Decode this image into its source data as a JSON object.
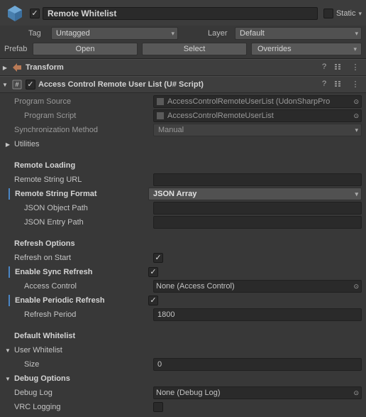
{
  "header": {
    "name": "Remote Whitelist",
    "static_label": "Static",
    "tag_label": "Tag",
    "tag_value": "Untagged",
    "layer_label": "Layer",
    "layer_value": "Default",
    "prefab_label": "Prefab",
    "open_btn": "Open",
    "select_btn": "Select",
    "overrides_btn": "Overrides"
  },
  "components": {
    "transform": {
      "title": "Transform"
    },
    "script": {
      "title": "Access Control Remote User List (U# Script)",
      "program_source_label": "Program Source",
      "program_source_value": "AccessControlRemoteUserList (UdonSharpPro",
      "program_script_label": "Program Script",
      "program_script_value": "AccessControlRemoteUserList",
      "sync_label": "Synchronization Method",
      "sync_value": "Manual",
      "utilities": "Utilities",
      "remote_loading": "Remote Loading",
      "remote_url_label": "Remote String URL",
      "remote_url_value": "",
      "remote_format_label": "Remote String Format",
      "remote_format_value": "JSON Array",
      "json_obj_label": "JSON Object Path",
      "json_obj_value": "",
      "json_entry_label": "JSON Entry Path",
      "json_entry_value": "",
      "refresh_options": "Refresh Options",
      "refresh_start_label": "Refresh on Start",
      "enable_sync_label": "Enable Sync Refresh",
      "access_control_label": "Access Control",
      "access_control_value": "None (Access Control)",
      "enable_periodic_label": "Enable Periodic Refresh",
      "refresh_period_label": "Refresh Period",
      "refresh_period_value": "1800",
      "default_whitelist": "Default Whitelist",
      "user_whitelist": "User Whitelist",
      "size_label": "Size",
      "size_value": "0",
      "debug_options": "Debug Options",
      "debug_log_label": "Debug Log",
      "debug_log_value": "None (Debug Log)",
      "vrc_logging_label": "VRC Logging"
    }
  }
}
